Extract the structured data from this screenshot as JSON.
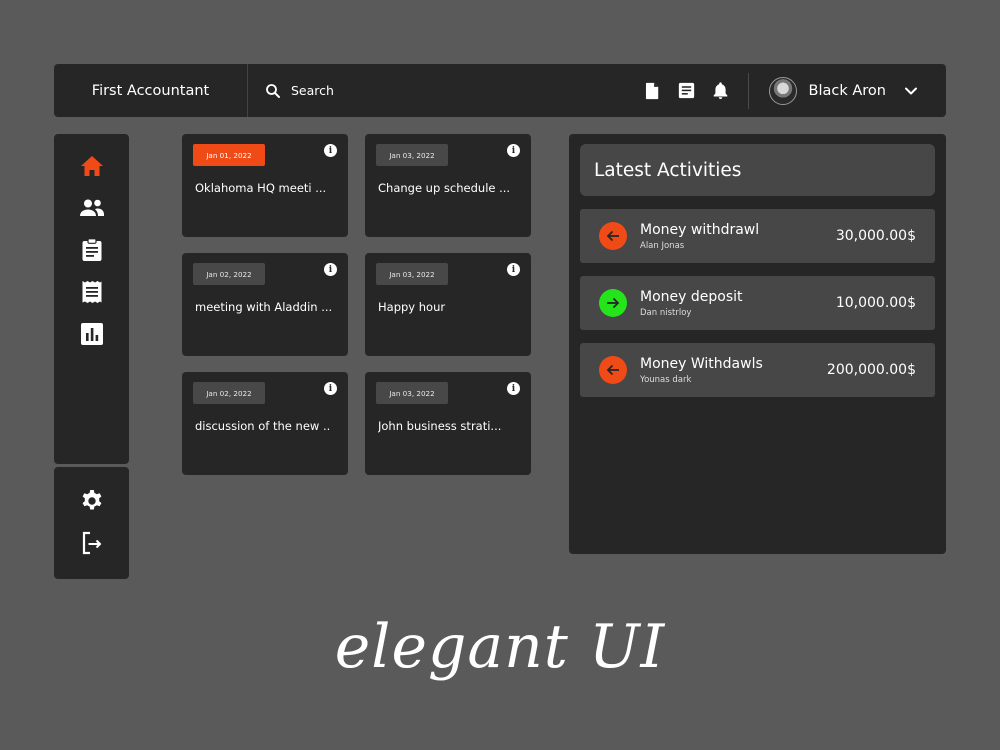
{
  "header": {
    "brand": "First Accountant",
    "search_placeholder": "Search",
    "user_name": "Black Aron"
  },
  "icons": {
    "search": "search-icon",
    "file": "file-icon",
    "notes": "notes-icon",
    "bell": "bell-icon",
    "chevron": "chevron-down-icon",
    "home": "home-icon",
    "people": "people-icon",
    "clipboard": "clipboard-icon",
    "receipt": "receipt-icon",
    "chart": "bar-chart-icon",
    "settings": "gear-icon",
    "logout": "logout-icon"
  },
  "colors": {
    "accent": "#f04a16",
    "success": "#24e51a",
    "panel": "#262626",
    "background": "#5a5a5a"
  },
  "cards": [
    {
      "date": "Jan 01, 2022",
      "title": "Oklahoma HQ meeti ...",
      "active": true
    },
    {
      "date": "Jan 03, 2022",
      "title": "Change up schedule ...",
      "active": false
    },
    {
      "date": "Jan 02, 2022",
      "title": "meeting with Aladdin ...",
      "active": false
    },
    {
      "date": "Jan 03, 2022",
      "title": "Happy hour",
      "active": false
    },
    {
      "date": "Jan 02, 2022",
      "title": "discussion of the new ..",
      "active": false
    },
    {
      "date": "Jan 03, 2022",
      "title": "John business strati...",
      "active": false
    }
  ],
  "activities": {
    "title": "Latest Activities",
    "items": [
      {
        "name": "Money withdrawl",
        "person": "Alan Jonas",
        "amount": "30,000.00$",
        "direction": "out"
      },
      {
        "name": "Money deposit",
        "person": "Dan nistrloy",
        "amount": "10,000.00$",
        "direction": "in"
      },
      {
        "name": "Money Withdawls",
        "person": "Younas dark",
        "amount": "200,000.00$",
        "direction": "out"
      }
    ]
  },
  "tagline": "elegant UI"
}
